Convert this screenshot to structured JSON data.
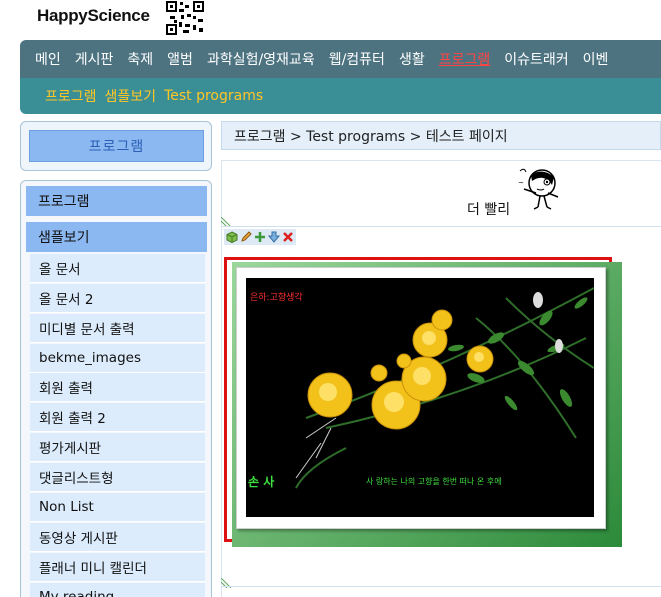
{
  "header": {
    "logo": "HappyScience"
  },
  "nav_main": {
    "items": [
      "메인",
      "게시판",
      "축제",
      "앨범",
      "과학실험/영재교육",
      "웹/컴퓨터",
      "생활",
      "프로그램",
      "이슈트래커",
      "이벤"
    ],
    "active_index": 7
  },
  "nav_sub": {
    "items": [
      "프로그램",
      "샘플보기",
      "Test programs"
    ]
  },
  "sidebar": {
    "title": "프로그램",
    "heads": [
      "프로그램",
      "샘플보기"
    ],
    "items": [
      "올 문서",
      "올 문서 2",
      "미디별 문서 출력",
      "bekme_images",
      "회원 출력",
      "회원 출력 2",
      "평가게시판",
      "댓글리스트형",
      "Non List",
      "동영상 게시판",
      "플래너 미니 캘린더",
      "My reading"
    ]
  },
  "breadcrumb": "프로그램 > Test programs > 테스트 페이지",
  "content": {
    "faster_text": "더 빨리",
    "photo_caption_top": "은하:고향생각",
    "photo_caption_bottom": "사 랑하는 나의 고향을 한번 떠나 온 후에",
    "photo_sign": "손 사"
  },
  "colors": {
    "nav_main_bg": "#4d7381",
    "nav_sub_bg": "#3a8f97",
    "nav_active": "#ff4444",
    "nav_sub_text": "#ffc524",
    "sidebar_head_bg": "#8bb8f0",
    "sidebar_item_bg": "#dcecfc"
  }
}
